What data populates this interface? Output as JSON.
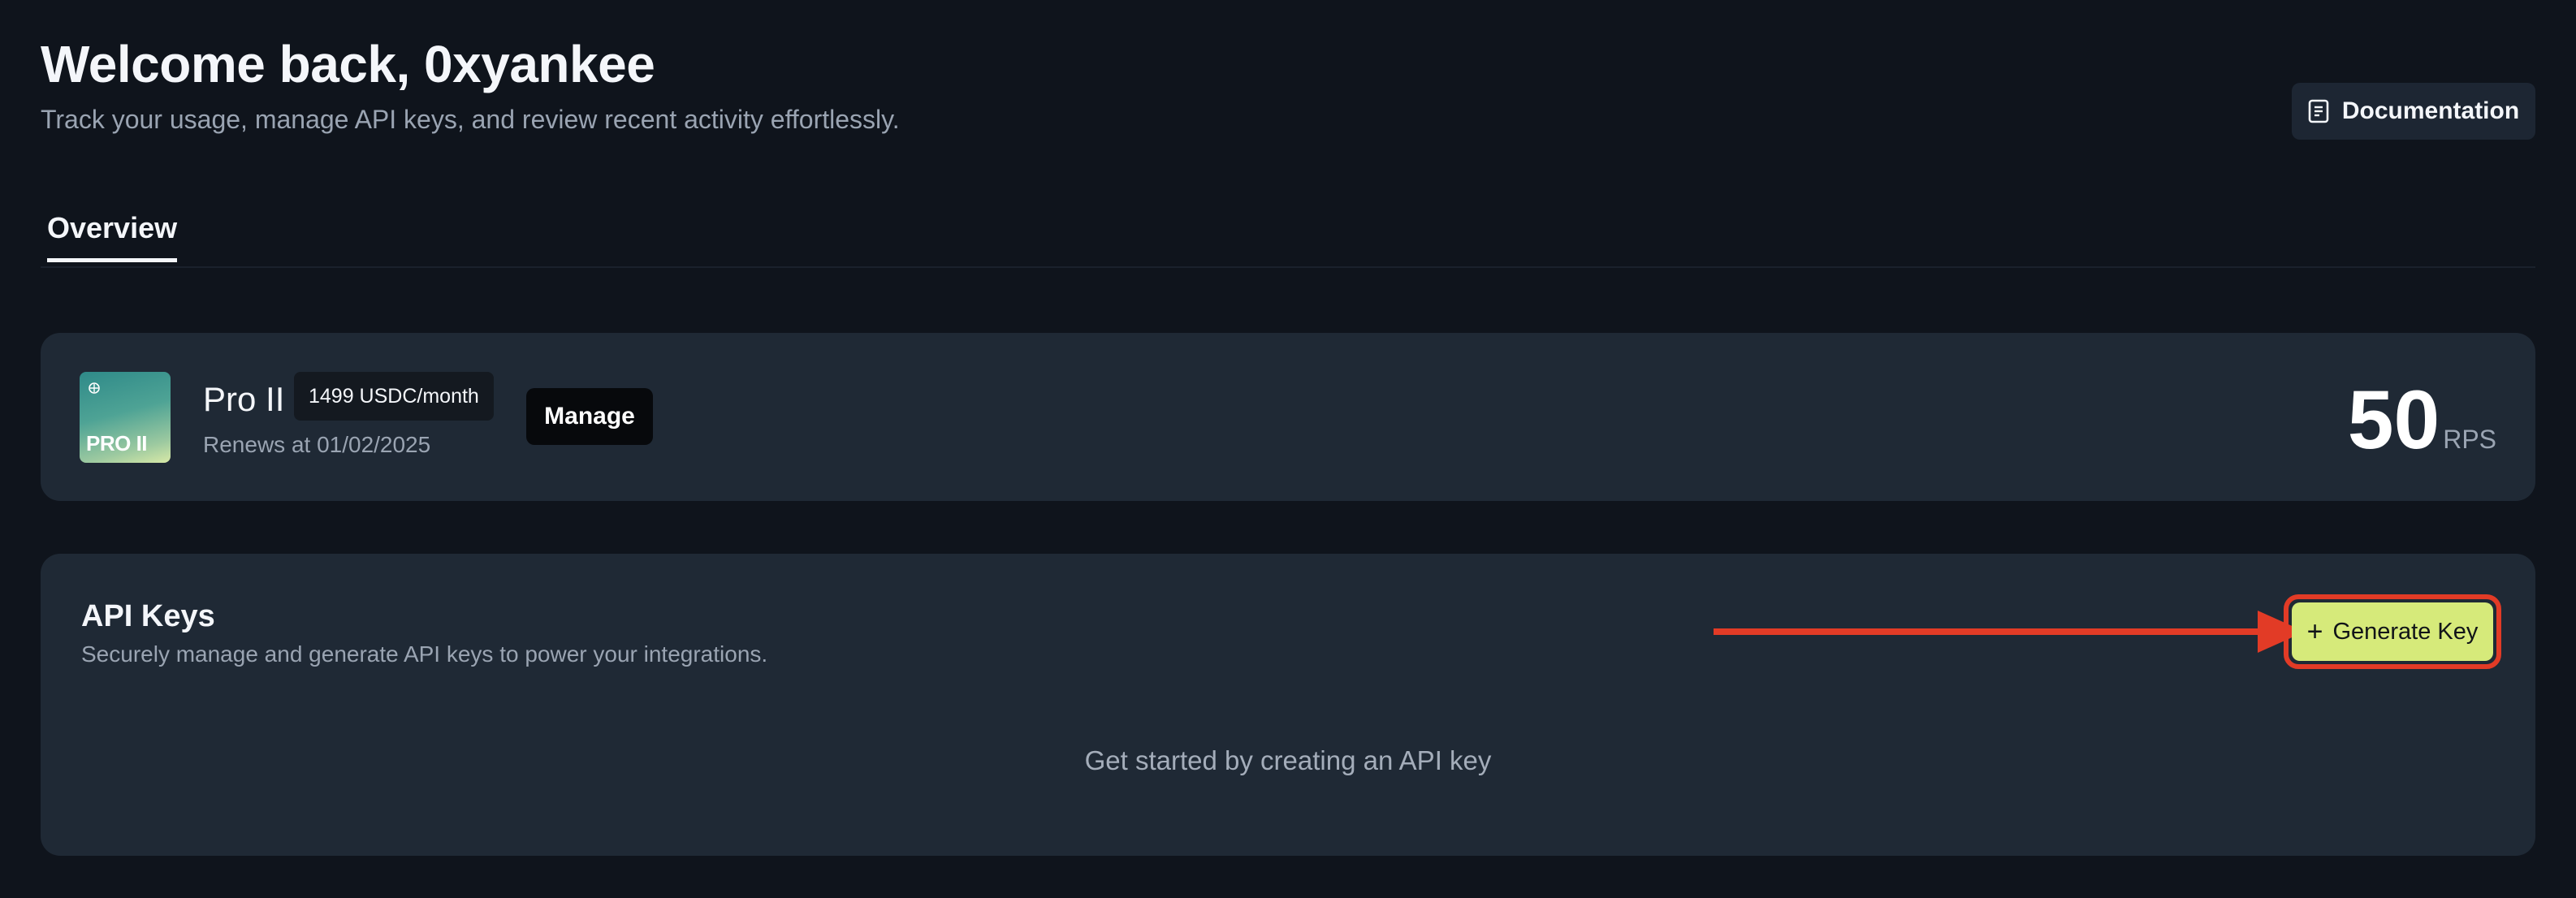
{
  "header": {
    "title": "Welcome back, 0xyankee",
    "subtitle": "Track your usage, manage API keys, and review recent activity effortlessly.",
    "documentation_label": "Documentation"
  },
  "tabs": [
    {
      "label": "Overview",
      "active": true
    }
  ],
  "plan": {
    "logo_text": "PRO II",
    "name": "Pro II",
    "price_badge": "1499 USDC/month",
    "renews": "Renews at 01/02/2025",
    "manage_label": "Manage",
    "rps_value": "50",
    "rps_unit": "RPS"
  },
  "api_keys": {
    "title": "API Keys",
    "description": "Securely manage and generate API keys to power your integrations.",
    "generate_label": "Generate Key",
    "empty_state": "Get started by creating an API key"
  },
  "colors": {
    "background": "#0f141c",
    "card": "#1f2935",
    "accent_button": "#d6ea7a",
    "annotation_red": "#e23b26"
  },
  "icons": {
    "documentation": "document-icon",
    "generate": "plus-icon"
  }
}
